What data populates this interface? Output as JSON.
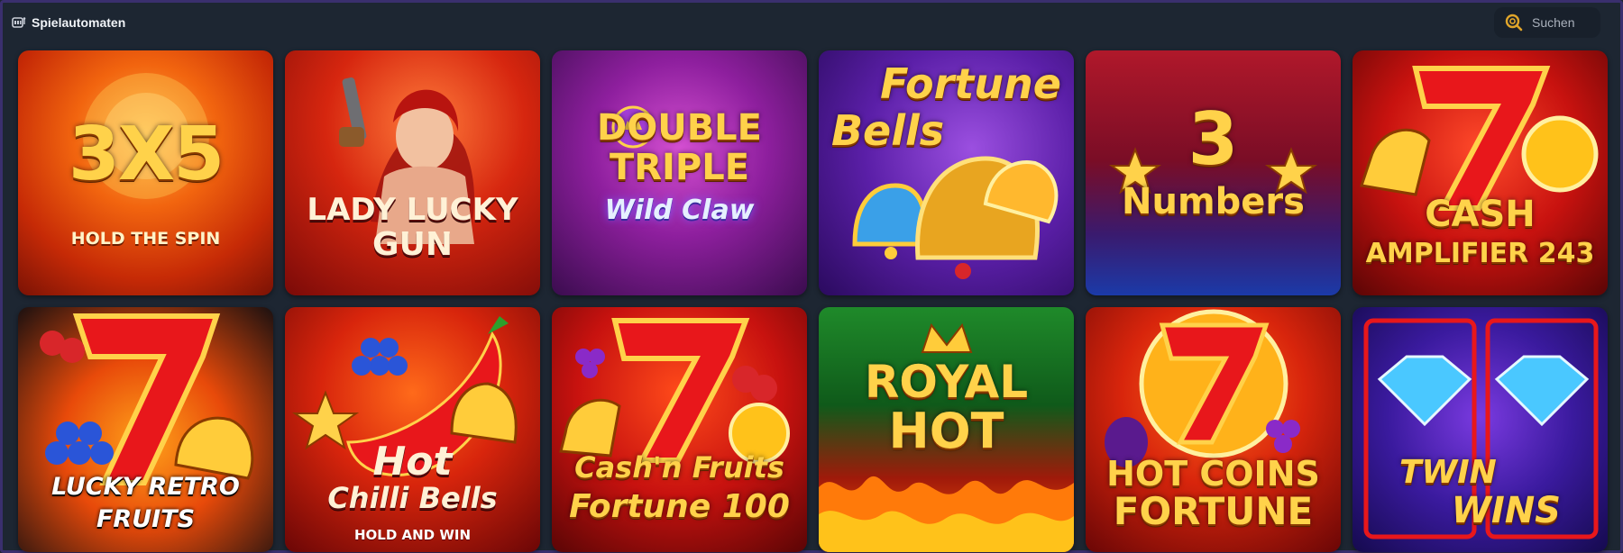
{
  "header": {
    "title": "Spielautomaten",
    "search_placeholder": "Suchen"
  },
  "games": [
    {
      "name": "3x5",
      "lines": [
        "3X5"
      ],
      "subtitle": "HOLD THE SPIN"
    },
    {
      "name": "Lady Lucky Gun",
      "lines": [
        "LADY LUCKY",
        "GUN"
      ],
      "subtitle": ""
    },
    {
      "name": "Double Triple Wild Claw",
      "lines": [
        "DOUBLE",
        "TRIPLE"
      ],
      "subtitle": "Wild Claw"
    },
    {
      "name": "Fortune Bells",
      "lines": [
        "Fortune",
        "Bells"
      ],
      "subtitle": ""
    },
    {
      "name": "3 Numbers",
      "lines": [
        "3",
        "Numbers"
      ],
      "subtitle": ""
    },
    {
      "name": "Cash Amplifier 243",
      "lines": [
        "CASH"
      ],
      "subtitle": "AMPLIFIER 243"
    },
    {
      "name": "Lucky Retro Fruits",
      "lines": [
        "LUCKY RETRO",
        "FRUITS"
      ],
      "subtitle": ""
    },
    {
      "name": "Hot Chilli Bells",
      "lines": [
        "Hot",
        "Chilli Bells"
      ],
      "subtitle": "HOLD AND WIN"
    },
    {
      "name": "Cash'n Fruits Fortune 100",
      "lines": [
        "Cash'n Fruits",
        "Fortune 100"
      ],
      "subtitle": ""
    },
    {
      "name": "Royal Hot",
      "lines": [
        "ROYAL",
        "HOT"
      ],
      "subtitle": ""
    },
    {
      "name": "Hot Coins Fortune",
      "lines": [
        "HOT COINS",
        "FORTUNE"
      ],
      "subtitle": ""
    },
    {
      "name": "Twin Wins",
      "lines": [
        "TWIN",
        "WINS"
      ],
      "subtitle": ""
    }
  ],
  "colors": {
    "background": "#1d2632",
    "frame_border": "#3a2f6e",
    "search_icon": "#e0a52a"
  }
}
